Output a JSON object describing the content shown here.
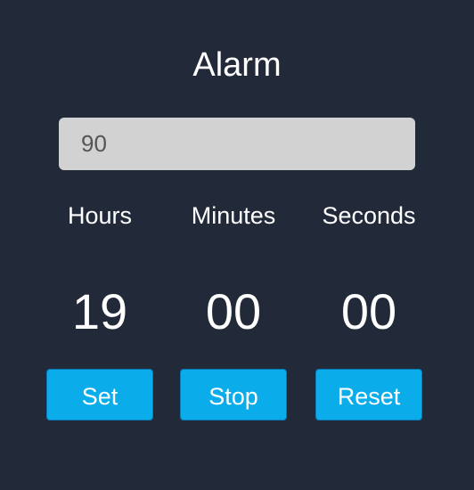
{
  "app": {
    "title": "Alarm"
  },
  "alarm_input": {
    "value": "90",
    "placeholder": ""
  },
  "time": {
    "labels": {
      "hours": "Hours",
      "minutes": "Minutes",
      "seconds": "Seconds"
    },
    "values": {
      "hours": "19",
      "minutes": "00",
      "seconds": "00"
    }
  },
  "buttons": {
    "set": "Set",
    "stop": "Stop",
    "reset": "Reset"
  },
  "colors": {
    "background": "#222a3a",
    "input_bg": "#d2d2d2",
    "button_bg": "#0aace9",
    "button_border": "#0b7bb8",
    "text": "#ffffff"
  }
}
